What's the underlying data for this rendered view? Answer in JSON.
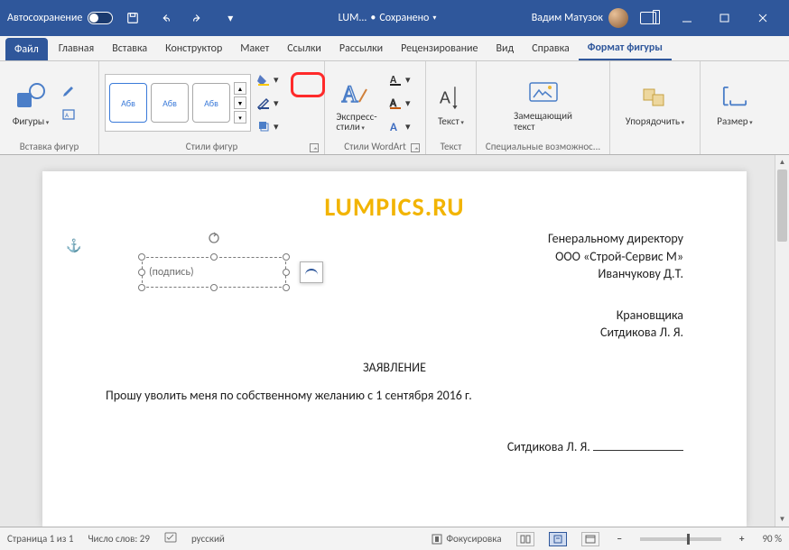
{
  "titlebar": {
    "autosave": "Автосохранение",
    "doc_title": "LUM...",
    "save_marker": "•",
    "saved_state": "Сохранено",
    "user_name": "Вадим Матузок"
  },
  "tabs": {
    "file": "Файл",
    "home": "Главная",
    "insert": "Вставка",
    "design": "Конструктор",
    "layout": "Макет",
    "references": "Ссылки",
    "mailings": "Рассылки",
    "review": "Рецензирование",
    "view": "Вид",
    "help": "Справка",
    "shape_format": "Формат фигуры"
  },
  "ribbon": {
    "insert_shapes_group": "Вставка фигур",
    "shapes_btn": "Фигуры",
    "shape_styles_group": "Стили фигур",
    "shape_style_text": "Абв",
    "wordart_group": "Стили WordArt",
    "wordart_btn": "Экспресс-",
    "wordart_btn2": "стили",
    "text_group": "Текст",
    "text_btn": "Текст",
    "access_group": "Специальные возможнос...",
    "alt_text_btn1": "Замещающий",
    "alt_text_btn2": "текст",
    "arrange_btn": "Упорядочить",
    "size_btn": "Размер"
  },
  "document": {
    "watermark": "LUMPICS.RU",
    "to_1": "Генеральному директору",
    "to_2": "ООО «Строй-Сервис М»",
    "to_3": "Иванчукову Д.Т.",
    "from_1": "Крановщика",
    "from_2": "Ситдикова Л. Я.",
    "caption": "ЗАЯВЛЕНИЕ",
    "body": "Прошу уволить меня по собственному желанию с 1 сентября 2016 г.",
    "sig_name": "Ситдикова Л. Я.",
    "textbox_placeholder": "(подпись)"
  },
  "statusbar": {
    "page": "Страница 1 из 1",
    "words": "Число слов: 29",
    "lang": "русский",
    "focus": "Фокусировка",
    "zoom": "90 %"
  }
}
